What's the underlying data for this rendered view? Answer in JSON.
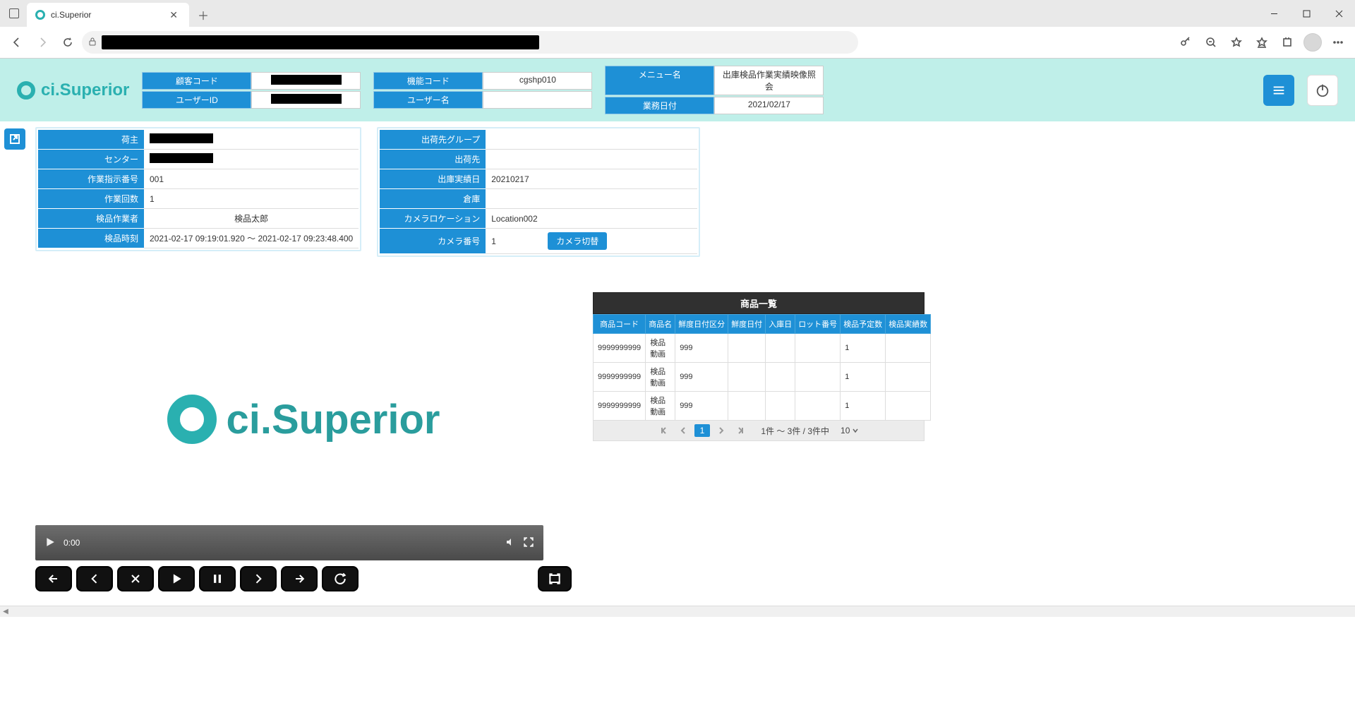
{
  "browser": {
    "tab_title": "ci.Superior"
  },
  "header": {
    "logo_text": "ci.Superior",
    "fields": {
      "customer_code_lbl": "顧客コード",
      "user_id_lbl": "ユーザーID",
      "function_code_lbl": "機能コード",
      "function_code_val": "cgshp010",
      "user_name_lbl": "ユーザー名",
      "user_name_val": "",
      "menu_name_lbl": "メニュー名",
      "menu_name_val": "出庫検品作業実績映像照会",
      "business_date_lbl": "業務日付",
      "business_date_val": "2021/02/17"
    }
  },
  "panel_left": {
    "owner_lbl": "荷主",
    "center_lbl": "センター",
    "work_no_lbl": "作業指示番号",
    "work_no_val": "001",
    "work_count_lbl": "作業回数",
    "work_count_val": "1",
    "inspector_lbl": "検品作業者",
    "inspector_val": "検品太郎",
    "inspect_time_lbl": "検品時刻",
    "inspect_time_val": "2021-02-17 09:19:01.920 ～ 2021-02-17 09:23:48.400"
  },
  "panel_right": {
    "ship_group_lbl": "出荷先グループ",
    "ship_group_val": "",
    "ship_to_lbl": "出荷先",
    "ship_to_val": "",
    "ship_date_lbl": "出庫実績日",
    "ship_date_val": "20210217",
    "warehouse_lbl": "倉庫",
    "warehouse_val": "",
    "cam_loc_lbl": "カメラロケーション",
    "cam_loc_val": "Location002",
    "cam_no_lbl": "カメラ番号",
    "cam_no_val": "1",
    "cam_swap_btn": "カメラ切替"
  },
  "video": {
    "logo_text": "ci.Superior",
    "time": "0:00"
  },
  "product_table": {
    "title": "商品一覧",
    "cols": {
      "code": "商品コード",
      "name": "商品名",
      "fresh_type": "鮮度日付区分",
      "fresh_date": "鮮度日付",
      "in_date": "入庫日",
      "lot": "ロット番号",
      "plan_qty": "検品予定数",
      "actual_qty": "検品実績数"
    },
    "rows": [
      {
        "code": "9999999999",
        "name": "検品動画",
        "fresh_type": "999",
        "fresh_date": "",
        "in_date": "",
        "lot": "",
        "plan_qty": "1",
        "actual_qty": ""
      },
      {
        "code": "9999999999",
        "name": "検品動画",
        "fresh_type": "999",
        "fresh_date": "",
        "in_date": "",
        "lot": "",
        "plan_qty": "1",
        "actual_qty": ""
      },
      {
        "code": "9999999999",
        "name": "検品動画",
        "fresh_type": "999",
        "fresh_date": "",
        "in_date": "",
        "lot": "",
        "plan_qty": "1",
        "actual_qty": ""
      }
    ],
    "pager": {
      "current": "1",
      "info": "1件 ～ 3件 / 3件中",
      "page_size": "10"
    }
  }
}
